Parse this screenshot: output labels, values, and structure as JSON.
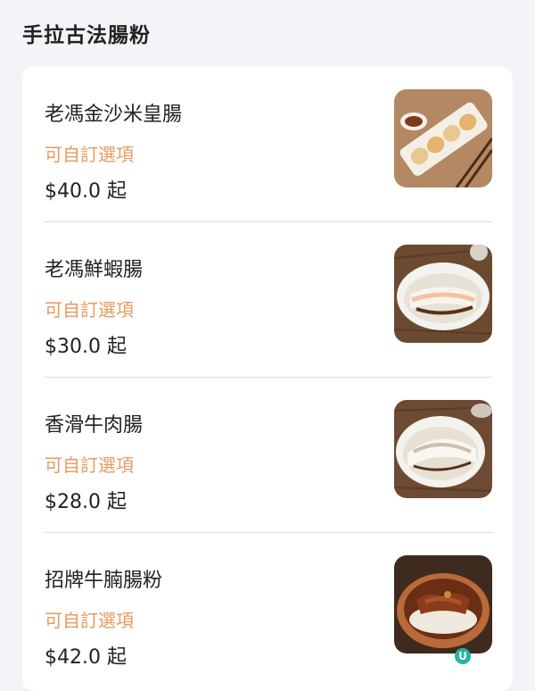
{
  "section": {
    "title": "手拉古法腸粉"
  },
  "items": [
    {
      "name": "老馮金沙米皇腸",
      "options": "可自訂選項",
      "price": "$40.0 起",
      "image_icon": "rice-roll-golden-sand-photo"
    },
    {
      "name": "老馮鮮蝦腸",
      "options": "可自訂選項",
      "price": "$30.0 起",
      "image_icon": "shrimp-rice-roll-photo"
    },
    {
      "name": "香滑牛肉腸",
      "options": "可自訂選項",
      "price": "$28.0 起",
      "image_icon": "beef-rice-roll-photo"
    },
    {
      "name": "招牌牛腩腸粉",
      "options": "可自訂選項",
      "price": "$42.0 起",
      "image_icon": "beef-brisket-rice-roll-photo"
    }
  ],
  "watermark": {
    "letter": "U"
  },
  "colors": {
    "background": "#f3f4f8",
    "card": "#ffffff",
    "option_text": "#e79a5c",
    "primary_text": "#222222",
    "divider": "#dcdcdc"
  }
}
